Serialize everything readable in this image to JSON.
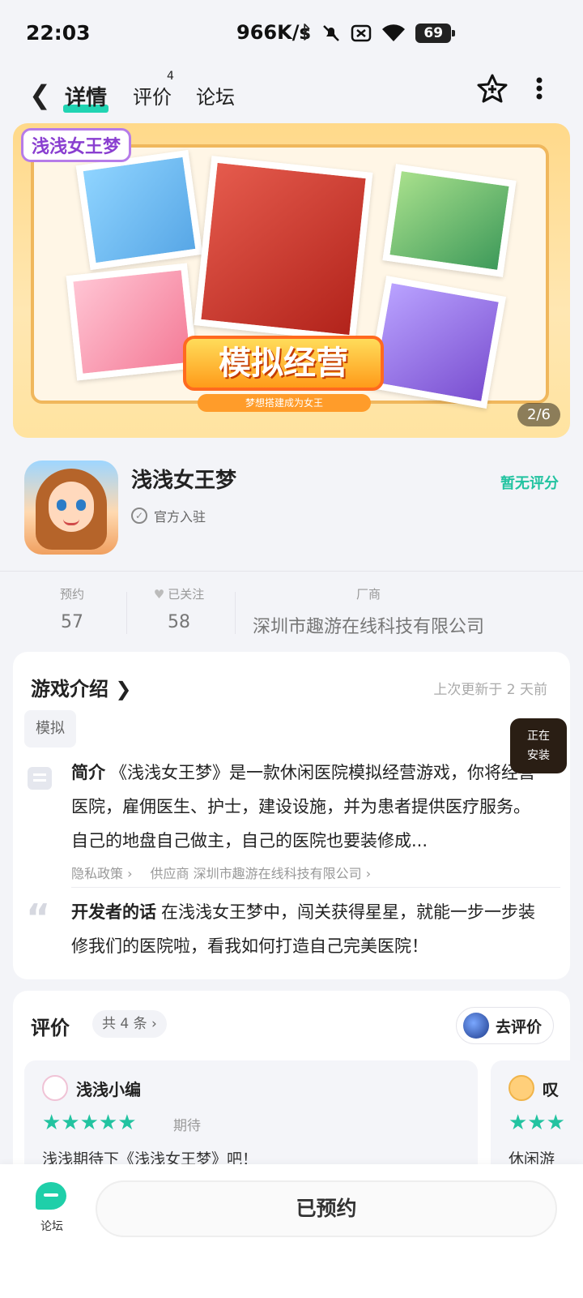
{
  "status_bar": {
    "time": "22:03",
    "net_speed": "966K/s",
    "battery": "69"
  },
  "nav": {
    "tabs": [
      {
        "label": "详情",
        "active": true
      },
      {
        "label": "评价",
        "badge": "4"
      },
      {
        "label": "论坛"
      }
    ]
  },
  "banner": {
    "logo_text": "浅浅女王梦",
    "headline": "模拟经营",
    "slogan": "梦想搭建成为女王",
    "pager": "2/6"
  },
  "app": {
    "name": "浅浅女王梦",
    "official": "官方入驻",
    "rating": "暂无评分"
  },
  "stats": [
    {
      "label": "预约",
      "value": "57"
    },
    {
      "label": "已关注",
      "value": "58"
    },
    {
      "label": "厂商",
      "value": "深圳市趣游在线科技有限公司"
    }
  ],
  "intro": {
    "title": "游戏介绍",
    "updated": "上次更新于 2 天前",
    "tag": "模拟",
    "summary_label": "简介",
    "summary_text": "《浅浅女王梦》是一款休闲医院模拟经营游戏，你将经营医院，雇佣医生、护士，建设设施，并为患者提供医疗服务。自己的地盘自己做主，自己的医院也要装修成...",
    "privacy": "隐私政策",
    "supplier_label": "供应商",
    "supplier": "深圳市趣游在线科技有限公司",
    "dev_label": "开发者的话",
    "dev_text": "在浅浅女王梦中，闯关获得星星，就能一步一步装修我们的医院啦，看我如何打造自己完美医院！"
  },
  "installing": [
    "正在",
    "安装"
  ],
  "reviews": {
    "title": "评价",
    "count": "共 4 条",
    "go_review": "去评价",
    "items": [
      {
        "user": "浅浅小编",
        "stars": 5,
        "tag": "期待",
        "text": "浅浅期待下《浅浅女王梦》吧！\n使简管理医护人员，加快治疗速度"
      },
      {
        "user": "叹",
        "stars": 3,
        "text": "休闲游"
      }
    ]
  },
  "bottom": {
    "forum": "论坛",
    "action": "已预约"
  },
  "colors": {
    "accent": "#22c3a0",
    "background": "#f3f4f8"
  }
}
